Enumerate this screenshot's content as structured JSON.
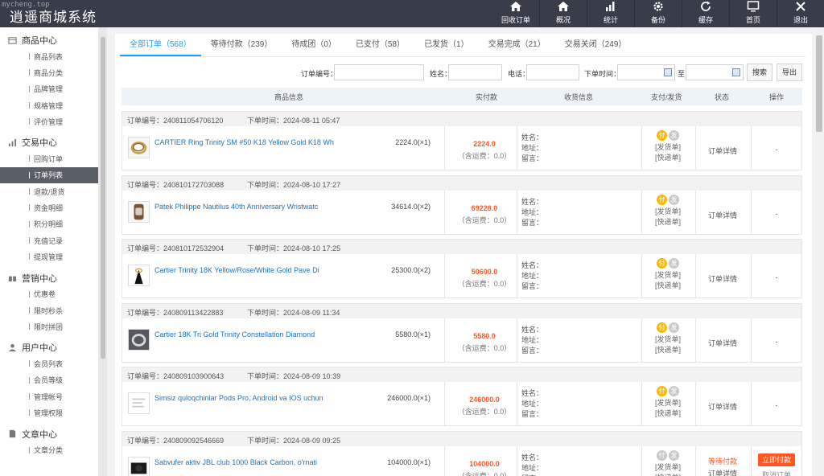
{
  "app": {
    "title": "逍遥商城系统",
    "watermark": "mycheng.top"
  },
  "topnav": [
    {
      "label": "回收订单",
      "icon": "home-icon"
    },
    {
      "label": "概况",
      "icon": "home-icon"
    },
    {
      "label": "统计",
      "icon": "bar-chart-icon"
    },
    {
      "label": "备份",
      "icon": "gear-icon"
    },
    {
      "label": "缓存",
      "icon": "refresh-icon"
    },
    {
      "label": "首页",
      "icon": "monitor-icon"
    },
    {
      "label": "退出",
      "icon": "close-icon"
    }
  ],
  "sidebar": {
    "groups": [
      {
        "title": "商品中心",
        "icon": "box-icon",
        "items": [
          "商品列表",
          "商品分类",
          "品牌管理",
          "规格管理",
          "评价管理"
        ]
      },
      {
        "title": "交易中心",
        "icon": "bar-chart-icon",
        "items": [
          "回购订单",
          "订单列表",
          "退款/退货",
          "资金明细",
          "积分明细",
          "充值记录",
          "提现管理"
        ]
      },
      {
        "title": "营销中心",
        "icon": "gift-icon",
        "items": [
          "优惠卷",
          "限时秒杀",
          "限时拼团"
        ]
      },
      {
        "title": "用户中心",
        "icon": "user-icon",
        "items": [
          "会员列表",
          "会员等级",
          "管理帐号",
          "管理权限"
        ]
      },
      {
        "title": "文章中心",
        "icon": "document-icon",
        "items": [
          "文章分类"
        ]
      }
    ],
    "active": "订单列表"
  },
  "tabs": [
    "全部订单（568）",
    "等待付款（239）",
    "待成团（0）",
    "已支付（58）",
    "已发货（1）",
    "交易完成（21）",
    "交易关闭（249）"
  ],
  "filters": {
    "order_no_label": "订单编号：",
    "name_label": "姓名：",
    "phone_label": "电话：",
    "time_label": "下单时间：",
    "to_label": "至",
    "search_button": "搜索",
    "export_button": "导出"
  },
  "table": {
    "headers": [
      "商品信息",
      "实付款",
      "收货信息",
      "支付/发货",
      "状态",
      "操作"
    ]
  },
  "labels": {
    "order_no_prefix": "订单编号：",
    "order_time_prefix": "下单时间：",
    "freight": "（含运费：0.0）",
    "recv_name": "姓名：",
    "recv_addr": "地址：",
    "recv_note": "留言：",
    "pay_badge": "付",
    "ship_badge": "发",
    "ship_order": "[发货单]",
    "express_order": "[快递单]",
    "detail": "订单详情",
    "dash": "-",
    "pay_now": "立即付款",
    "cancel_order": "取消订单"
  },
  "orders": [
    {
      "order_no": "240811054706120",
      "time": "2024-08-11 05:47",
      "product": "CARTIER Ring Trinity SM #50 K18 Yellow Gold K18 Wh",
      "qty": "2224.0(×1)",
      "paid": "2224.0",
      "status": "订单详情",
      "op": "-",
      "paid_badge": true
    },
    {
      "order_no": "240810172703088",
      "time": "2024-08-10 17:27",
      "product": "Patek Philippe Nautilus 40th Anniversary Wristwatc",
      "qty": "34614.0(×2)",
      "paid": "69228.0",
      "status": "订单详情",
      "op": "-",
      "paid_badge": true
    },
    {
      "order_no": "240810172532904",
      "time": "2024-08-10 17:25",
      "product": "Cartier Trinity 18K Yellow/Rose/White Gold Pave Di",
      "qty": "25300.0(×2)",
      "paid": "50600.0",
      "status": "订单详情",
      "op": "-",
      "paid_badge": true
    },
    {
      "order_no": "240809113422883",
      "time": "2024-08-09 11:34",
      "product": "Cartier 18K Tri Gold Trinity Constellation Diamond",
      "qty": "5580.0(×1)",
      "paid": "5580.0",
      "status": "订单详情",
      "op": "-",
      "paid_badge": true
    },
    {
      "order_no": "240809103900643",
      "time": "2024-08-09 10:39",
      "product": "Simsiz quloqchinlar Pods Pro, Android va IOS uchun",
      "qty": "246000.0(×1)",
      "paid": "246000.0",
      "status": "订单详情",
      "op": "-",
      "paid_badge": true
    },
    {
      "order_no": "240809092546669",
      "time": "2024-08-09 09:25",
      "product": "Sabvufer aktiv JBL club 1000 Black Carbon, o'rnati",
      "qty": "104000.0(×1)",
      "paid": "104000.0",
      "status": "等待付款",
      "op": "立即付款",
      "paid_badge": false
    }
  ]
}
